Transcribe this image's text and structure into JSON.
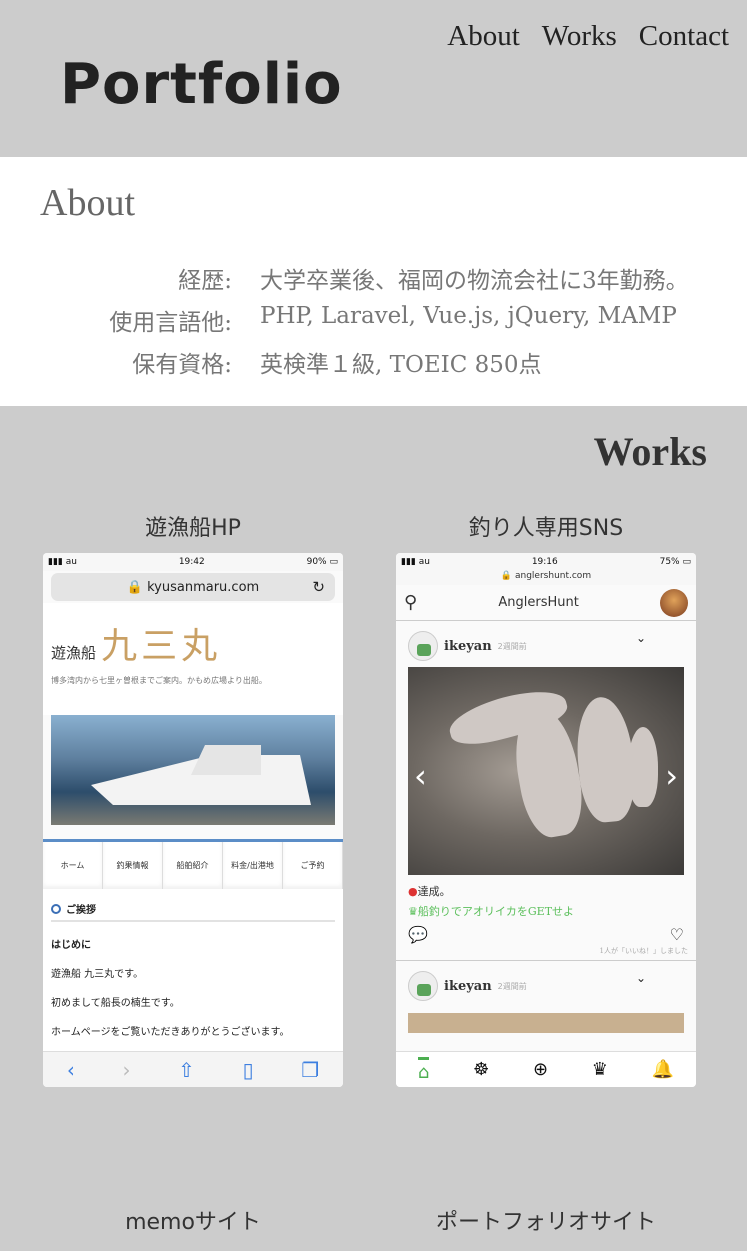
{
  "header": {
    "logo": "Portfolio",
    "nav": [
      "About",
      "Works",
      "Contact"
    ]
  },
  "about": {
    "title": "About",
    "rows": [
      {
        "key": "経歴:",
        "value": "大学卒業後、福岡の物流会社に3年勤務。"
      },
      {
        "key": "使用言語他:",
        "value": "PHP, Laravel, Vue.js, jQuery, MAMP"
      },
      {
        "key": "保有資格:",
        "value": "英検準１級, TOEIC 850点"
      }
    ]
  },
  "works": {
    "title": "Works",
    "items": [
      {
        "label": "遊漁船HP"
      },
      {
        "label": "釣り人専用SNS"
      },
      {
        "label": "memoサイト"
      },
      {
        "label": "ポートフォリオサイト"
      }
    ]
  },
  "phone1": {
    "carrier": "au",
    "time": "19:42",
    "battery": "90%",
    "url": "kyusanmaru.com",
    "ship_prefix": "遊漁船",
    "ship_name": "九三丸",
    "subtitle": "博多湾内から七里ヶ曽根までご案内。かもめ広場より出船。",
    "nav": [
      "ホーム",
      "釣果情報",
      "船舶紹介",
      "料金/出港地",
      "ご予約"
    ],
    "section_title": "ご挨拶",
    "paragraphs": [
      "はじめに",
      "遊漁船 九三丸です。",
      "初めまして船長の楠生です。",
      "ホームページをご覧いただきありがとうございます。"
    ]
  },
  "phone2": {
    "carrier": "au",
    "time": "19:16",
    "battery": "75%",
    "url": "anglershunt.com",
    "app_title": "AnglersHunt",
    "posts": [
      {
        "user": "ikeyan",
        "time": "2週間前"
      },
      {
        "user": "ikeyan",
        "time": "2週間前"
      }
    ],
    "text1": "達成。",
    "text2": "船釣りでアオリイカをGETせよ",
    "likes": "1人が「いいね！」しました"
  }
}
